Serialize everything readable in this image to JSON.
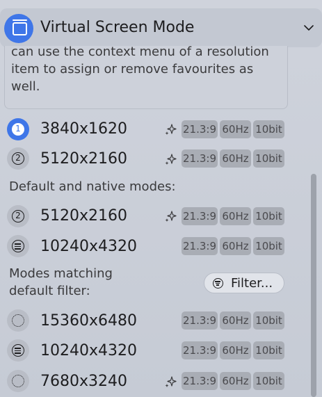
{
  "header": {
    "title": "Virtual Screen Mode"
  },
  "note": {
    "lines": [
      "can use the context menu of a resolution",
      "item to assign or remove favourites as",
      "well."
    ]
  },
  "favourites": [
    {
      "badge": "1",
      "resolution": "3840x1620",
      "ratio": "21.3:9",
      "refresh": "60Hz",
      "depth": "10bit"
    },
    {
      "badge": "2",
      "resolution": "5120x2160",
      "ratio": "21.3:9",
      "refresh": "60Hz",
      "depth": "10bit"
    }
  ],
  "sections": {
    "default_native": "Default and native modes:",
    "matching_line1": "Modes matching",
    "matching_line2": "default filter:"
  },
  "native_modes": [
    {
      "badge": "2",
      "resolution": "5120x2160",
      "ratio": "21.3:9",
      "refresh": "60Hz",
      "depth": "10bit"
    },
    {
      "badge": "",
      "resolution": "10240x4320",
      "ratio": "21.3:9",
      "refresh": "60Hz",
      "depth": "10bit"
    }
  ],
  "filter_button": {
    "label": "Filter..."
  },
  "matching_modes": [
    {
      "resolution": "15360x6480",
      "ratio": "21.3:9",
      "refresh": "60Hz",
      "depth": "10bit"
    },
    {
      "resolution": "10240x4320",
      "ratio": "21.3:9",
      "refresh": "60Hz",
      "depth": "10bit"
    },
    {
      "resolution": "7680x3240",
      "ratio": "21.3:9",
      "refresh": "60Hz",
      "depth": "10bit"
    }
  ],
  "colors": {
    "accent": "#3f76e8",
    "tag_bg": "#a9adb5"
  },
  "icons": {
    "app": "virtual-screen-icon",
    "chevron": "chevron-down-icon",
    "sparkle": "sparkle-icon",
    "filter": "filter-icon"
  }
}
